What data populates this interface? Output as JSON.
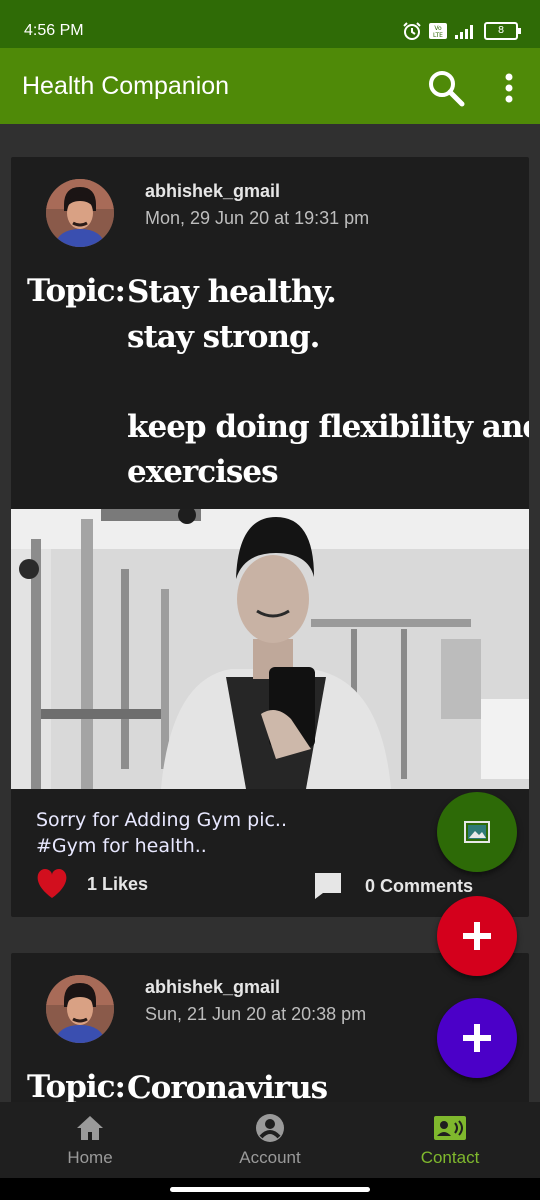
{
  "status_bar": {
    "time": "4:56 PM",
    "battery": "8",
    "icons": [
      "alarm-icon",
      "volte-icon",
      "signal-icon",
      "battery-icon"
    ]
  },
  "app_bar": {
    "title": "Health Companion",
    "icons": [
      "search-icon",
      "more-vert-icon"
    ]
  },
  "posts": [
    {
      "username": "abhishek_gmail",
      "timestamp": "Mon, 29 Jun 20 at 19:31 pm",
      "topic_label": "Topic:",
      "topic_text": "Stay healthy.\nstay strong.\n\nkeep doing flexibility and strength\nexercises",
      "caption": "Sorry for Adding Gym pic..\n#Gym for health..",
      "likes": "1 Likes",
      "comments": "0 Comments"
    },
    {
      "username": "abhishek_gmail",
      "timestamp": "Sun, 21 Jun 20 at 20:38 pm",
      "topic_label": "Topic:",
      "topic_text": "Coronavirus"
    }
  ],
  "fabs": {
    "gallery_color": "#2d6a07",
    "add_red_color": "#d4001c",
    "add_purple_color": "#4b00c8"
  },
  "bottom_nav": [
    {
      "label": "Home",
      "icon": "home-icon",
      "active": false
    },
    {
      "label": "Account",
      "icon": "account-circle-icon",
      "active": false
    },
    {
      "label": "Contact",
      "icon": "contact-card-icon",
      "active": true
    }
  ],
  "colors": {
    "status_bar": "#2f6b06",
    "app_bar": "#4f8a08",
    "card": "#1d1d1d",
    "background": "#303030",
    "active_nav": "#7fb82d",
    "like_heart": "#d20f1e"
  }
}
